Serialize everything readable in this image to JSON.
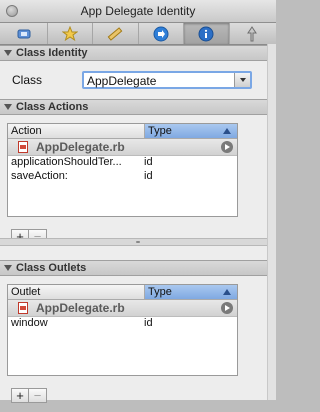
{
  "window": {
    "title": "App Delegate Identity"
  },
  "toolbar": {
    "tabs": [
      {
        "icon": "attributes-icon"
      },
      {
        "icon": "effects-icon"
      },
      {
        "icon": "size-icon"
      },
      {
        "icon": "connections-icon"
      },
      {
        "icon": "identity-icon"
      },
      {
        "icon": "bindings-icon"
      }
    ],
    "active_index": 4
  },
  "class_identity": {
    "header": "Class Identity",
    "label": "Class",
    "value": "AppDelegate"
  },
  "class_actions": {
    "header": "Class Actions",
    "columns": [
      "Action",
      "Type"
    ],
    "group": "AppDelegate.rb",
    "rows": [
      {
        "name": "applicationShouldTer...",
        "type": "id"
      },
      {
        "name": "saveAction:",
        "type": "id"
      }
    ],
    "add_label": "+",
    "remove_label": "−"
  },
  "class_outlets": {
    "header": "Class Outlets",
    "columns": [
      "Outlet",
      "Type"
    ],
    "group": "AppDelegate.rb",
    "rows": [
      {
        "name": "window",
        "type": "id"
      }
    ],
    "add_label": "+",
    "remove_label": "−"
  }
}
